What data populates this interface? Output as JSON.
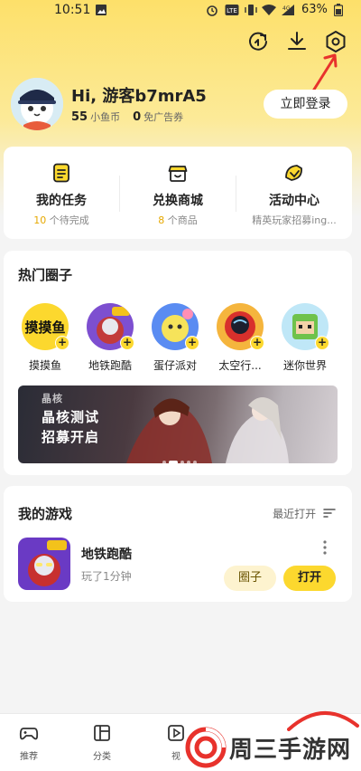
{
  "status_bar": {
    "time": "10:51",
    "battery": "63%"
  },
  "profile": {
    "greeting": "Hi, 游客b7mrA5",
    "fish_coins_value": "55",
    "fish_coins_label": "小鱼币",
    "ad_free_value": "0",
    "ad_free_label": "免广告券",
    "login_label": "立即登录"
  },
  "quick_links": [
    {
      "title": "我的任务",
      "sub_value": "10",
      "sub_text": "个待完成",
      "icon": "task-list-icon"
    },
    {
      "title": "兑换商城",
      "sub_value": "8",
      "sub_text": "个商品",
      "icon": "shop-icon"
    },
    {
      "title": "活动中心",
      "sub_value": "",
      "sub_text": "精英玩家招募ing...",
      "icon": "megaphone-icon"
    }
  ],
  "hot_circles": {
    "title": "热门圈子",
    "items": [
      {
        "name": "摸摸鱼"
      },
      {
        "name": "地铁跑酷"
      },
      {
        "name": "蛋仔派对"
      },
      {
        "name": "太空行..."
      },
      {
        "name": "迷你世界"
      }
    ],
    "banner": {
      "line1": "晶核测试",
      "line2": "招募开启",
      "logo_text": "晶核"
    }
  },
  "my_games": {
    "title": "我的游戏",
    "sort_label": "最近打开",
    "games": [
      {
        "name": "地铁跑酷",
        "played": "玩了1分钟",
        "circle_label": "圈子",
        "open_label": "打开"
      }
    ]
  },
  "bottom_nav": [
    {
      "label": "推荐",
      "icon": "gamepad-icon"
    },
    {
      "label": "分类",
      "icon": "category-icon"
    },
    {
      "label": "视",
      "icon": "video-icon"
    }
  ],
  "watermark": {
    "text": "周三手游网"
  },
  "colors": {
    "accent": "#fcd82e",
    "highlight": "#e6a800",
    "annotation": "#e8322c"
  }
}
